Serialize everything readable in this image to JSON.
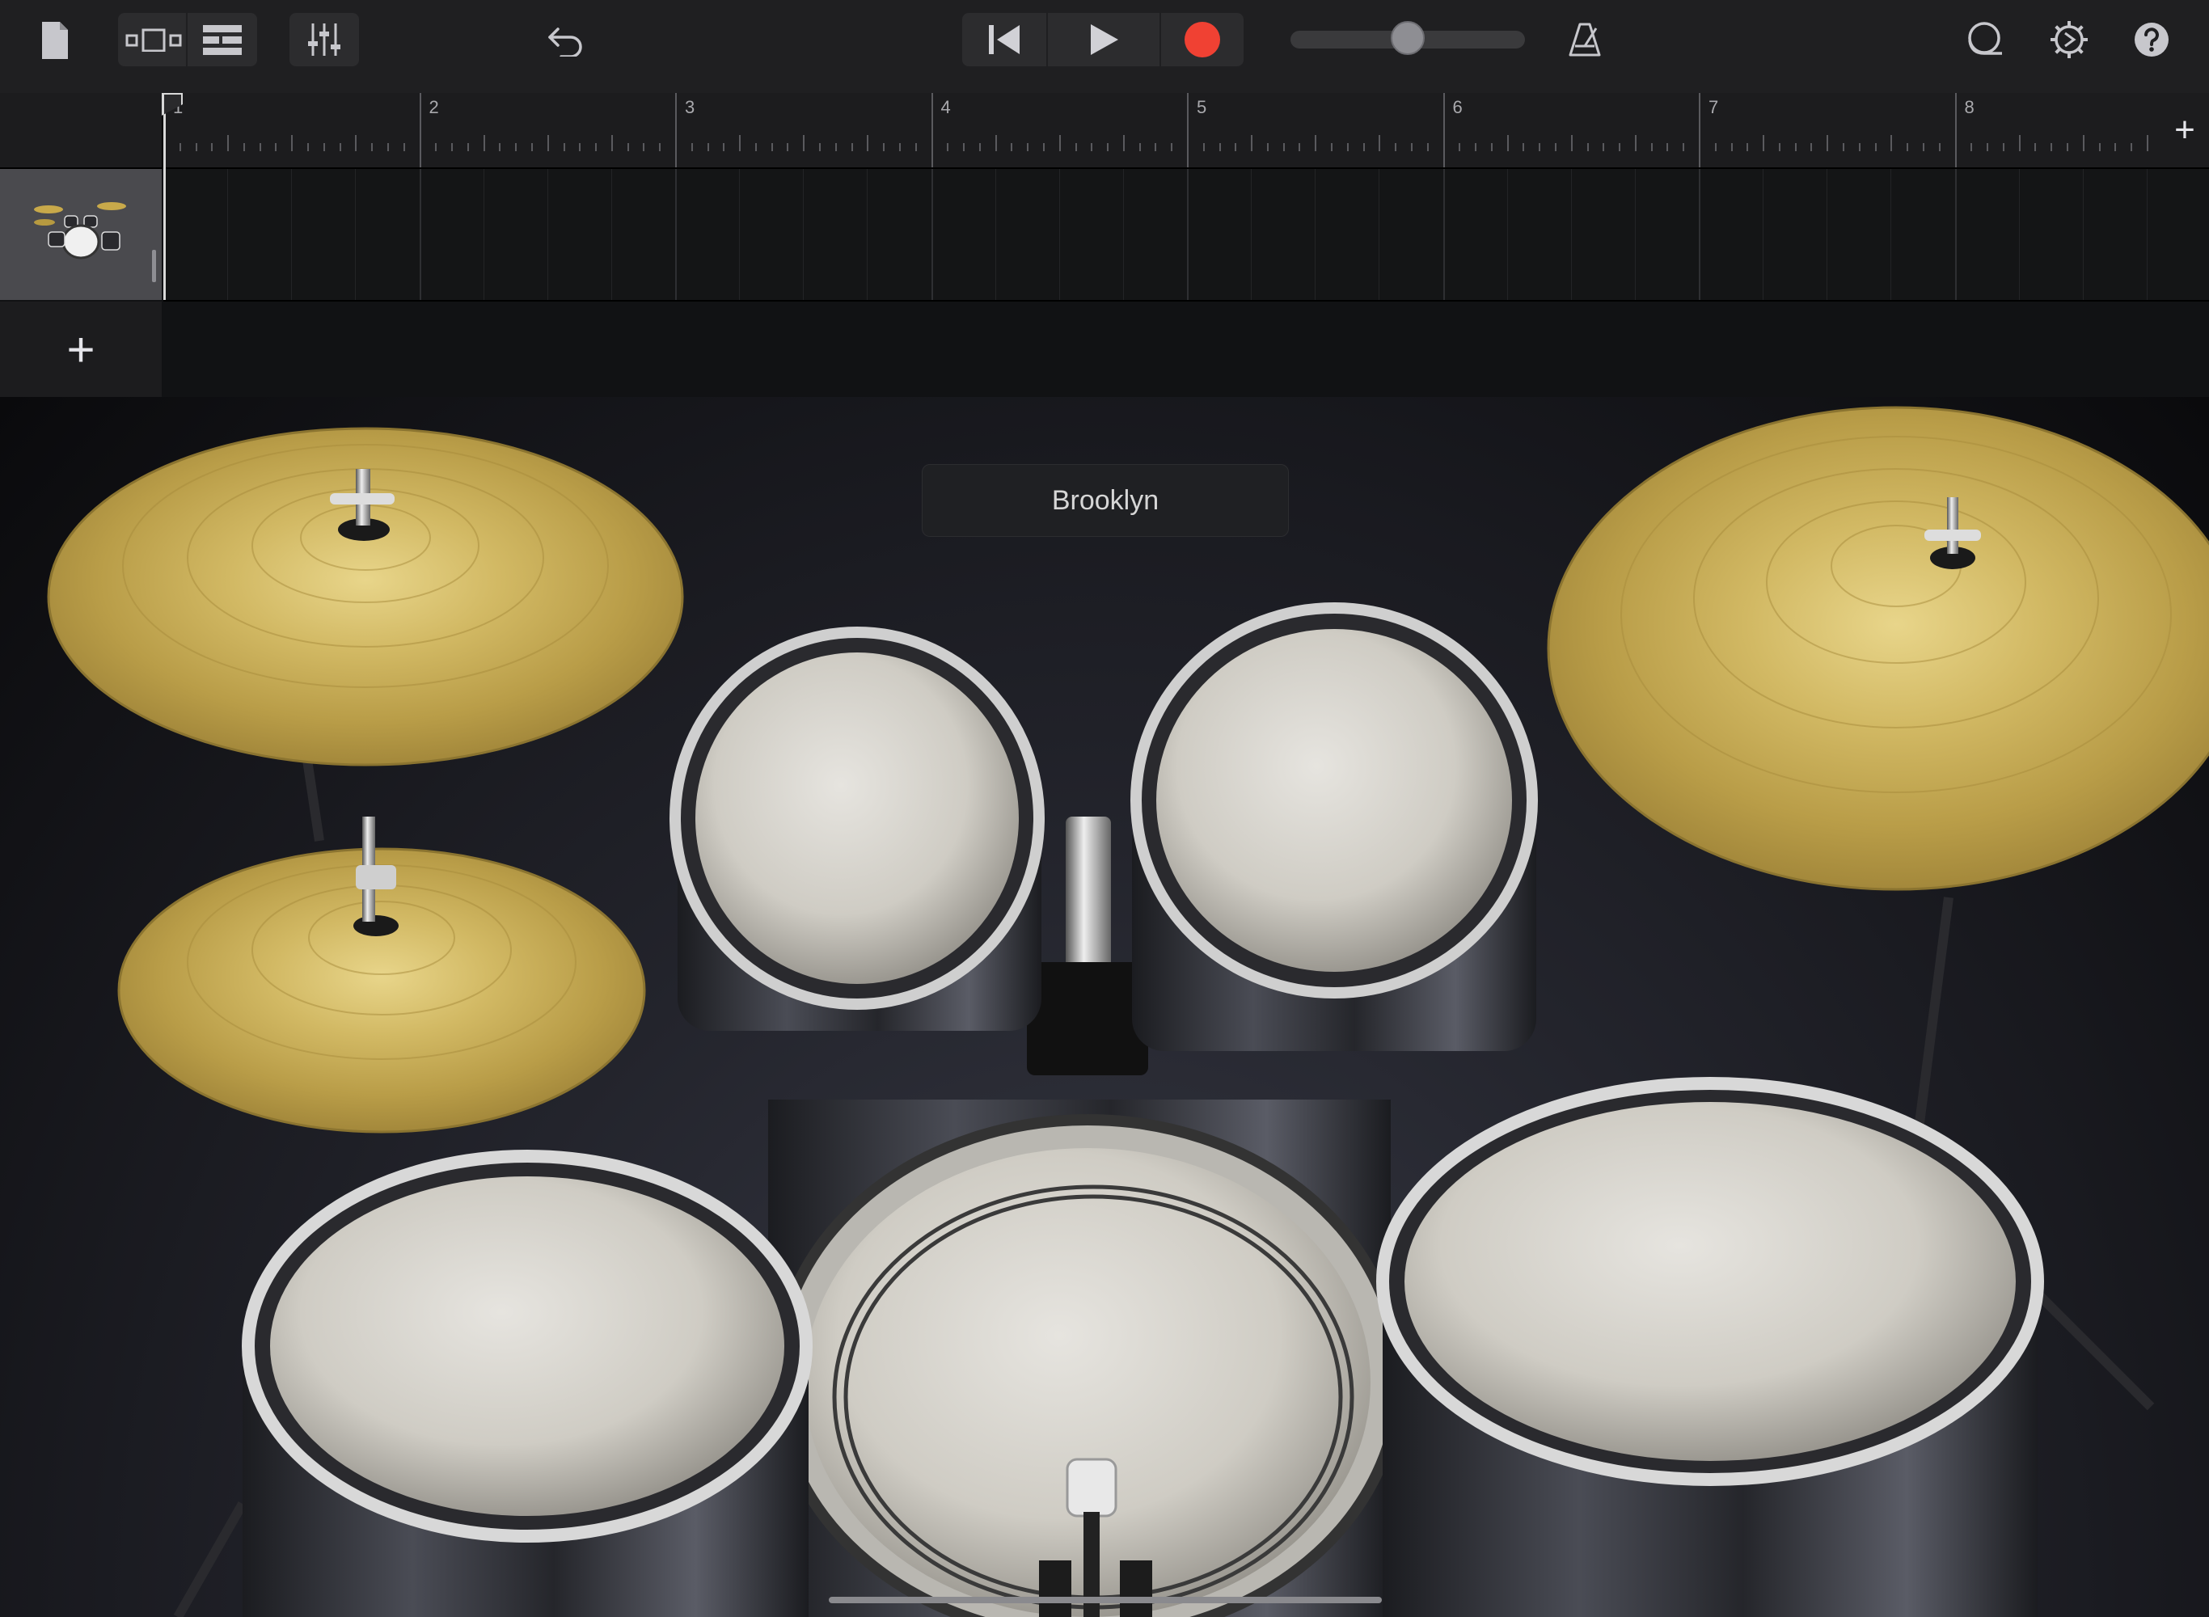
{
  "toolbar": {
    "icons": [
      "document-icon",
      "browser-view-icon",
      "tracks-view-icon",
      "mixer-icon",
      "undo-icon",
      "rewind-icon",
      "play-icon",
      "record-icon",
      "metronome-icon",
      "loop-icon",
      "settings-icon",
      "help-icon"
    ],
    "master_volume": 0.5,
    "colors": {
      "record": "#f04133",
      "background": "#1f1f21"
    }
  },
  "ruler": {
    "bars": [
      "1",
      "2",
      "3",
      "4",
      "5",
      "6",
      "7",
      "8"
    ],
    "add_section_label": "+"
  },
  "tracks": {
    "items": [
      {
        "instrument_icon": "drum-kit-icon"
      }
    ],
    "add_track_label": "+"
  },
  "kit": {
    "name": "Brooklyn",
    "pieces": [
      "crash-cymbal",
      "hi-hat",
      "ride-cymbal",
      "tom-1",
      "tom-2",
      "snare",
      "kick-drum",
      "floor-tom"
    ]
  }
}
